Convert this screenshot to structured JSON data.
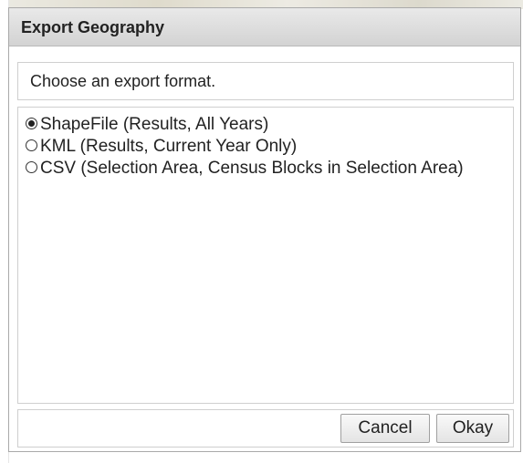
{
  "dialog": {
    "title": "Export Geography",
    "prompt": "Choose an export format.",
    "options": [
      {
        "label": "ShapeFile (Results, All Years)",
        "selected": true
      },
      {
        "label": "KML (Results, Current Year Only)",
        "selected": false
      },
      {
        "label": "CSV (Selection Area, Census Blocks in Selection Area)",
        "selected": false
      }
    ],
    "buttons": {
      "cancel_label": "Cancel",
      "okay_label": "Okay"
    }
  }
}
